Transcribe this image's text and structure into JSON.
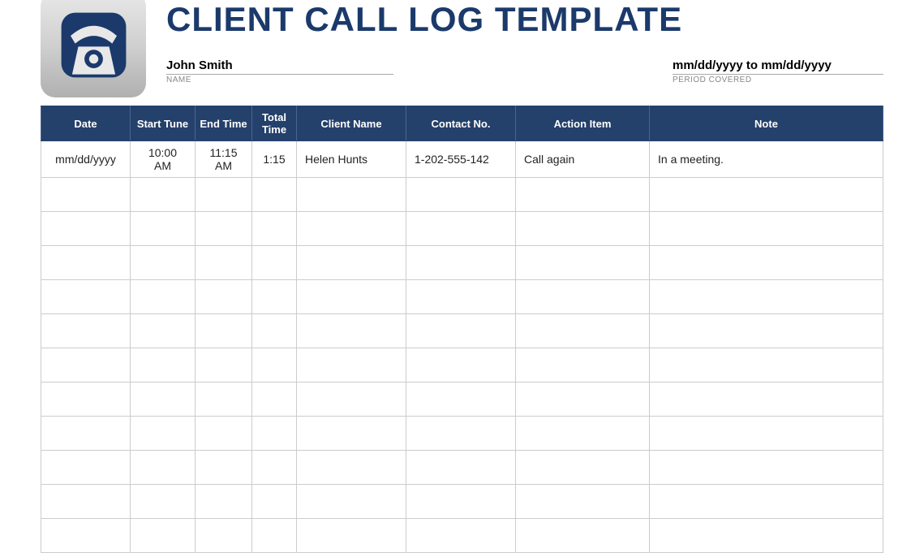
{
  "header": {
    "title": "CLIENT CALL LOG TEMPLATE",
    "name_value": "John Smith",
    "name_label": "NAME",
    "period_value": "mm/dd/yyyy to mm/dd/yyyy",
    "period_label": "PERIOD COVERED"
  },
  "table": {
    "columns": [
      "Date",
      "Start Tune",
      "End Time",
      "Total Time",
      "Client Name",
      "Contact No.",
      "Action Item",
      "Note"
    ],
    "rows": [
      {
        "date": "mm/dd/yyyy",
        "start": "10:00 AM",
        "end": "11:15 AM",
        "total": "1:15",
        "client": "Helen Hunts",
        "contact": "1-202-555-142",
        "action": "Call again",
        "note": "In a meeting."
      },
      {
        "date": "",
        "start": "",
        "end": "",
        "total": "",
        "client": "",
        "contact": "",
        "action": "",
        "note": ""
      },
      {
        "date": "",
        "start": "",
        "end": "",
        "total": "",
        "client": "",
        "contact": "",
        "action": "",
        "note": ""
      },
      {
        "date": "",
        "start": "",
        "end": "",
        "total": "",
        "client": "",
        "contact": "",
        "action": "",
        "note": ""
      },
      {
        "date": "",
        "start": "",
        "end": "",
        "total": "",
        "client": "",
        "contact": "",
        "action": "",
        "note": ""
      },
      {
        "date": "",
        "start": "",
        "end": "",
        "total": "",
        "client": "",
        "contact": "",
        "action": "",
        "note": ""
      },
      {
        "date": "",
        "start": "",
        "end": "",
        "total": "",
        "client": "",
        "contact": "",
        "action": "",
        "note": ""
      },
      {
        "date": "",
        "start": "",
        "end": "",
        "total": "",
        "client": "",
        "contact": "",
        "action": "",
        "note": ""
      },
      {
        "date": "",
        "start": "",
        "end": "",
        "total": "",
        "client": "",
        "contact": "",
        "action": "",
        "note": ""
      },
      {
        "date": "",
        "start": "",
        "end": "",
        "total": "",
        "client": "",
        "contact": "",
        "action": "",
        "note": ""
      },
      {
        "date": "",
        "start": "",
        "end": "",
        "total": "",
        "client": "",
        "contact": "",
        "action": "",
        "note": ""
      },
      {
        "date": "",
        "start": "",
        "end": "",
        "total": "",
        "client": "",
        "contact": "",
        "action": "",
        "note": ""
      }
    ]
  }
}
